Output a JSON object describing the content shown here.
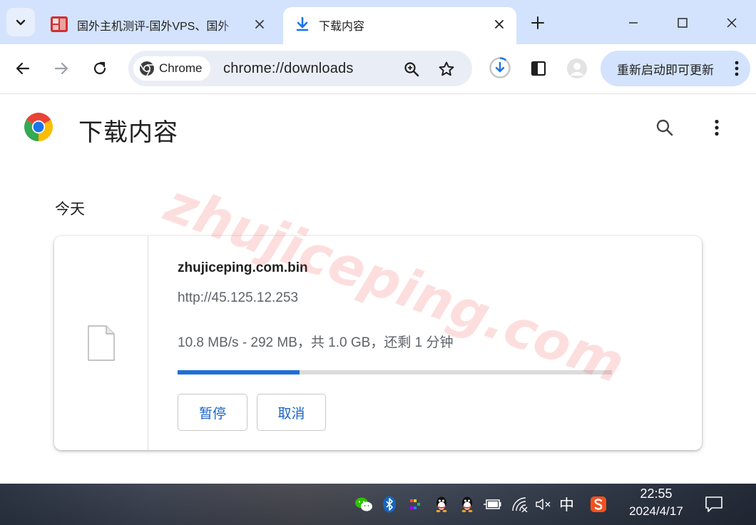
{
  "tabs": [
    {
      "title": "国外主机测评-国外VPS、国外",
      "active": false
    },
    {
      "title": "下载内容",
      "active": true
    }
  ],
  "toolbar": {
    "chip_label": "Chrome",
    "url": "chrome://downloads",
    "update_label": "重新启动即可更新"
  },
  "page": {
    "title": "下载内容",
    "section_header": "今天"
  },
  "download": {
    "file_name": "zhujiceping.com.bin",
    "url": "http://45.125.12.253",
    "status": "10.8 MB/s - 292 MB，共 1.0 GB，还剩 1 分钟",
    "progress_fraction": 0.28,
    "pause_label": "暂停",
    "cancel_label": "取消"
  },
  "watermark": "zhujiceping.com",
  "taskbar": {
    "ime": "中",
    "time": "22:55",
    "date": "2024/4/17"
  },
  "colors": {
    "tabstrip_bg": "#d3e3fd",
    "accent_blue": "#1a64c8",
    "progress_fill": "#1f6fd6"
  }
}
